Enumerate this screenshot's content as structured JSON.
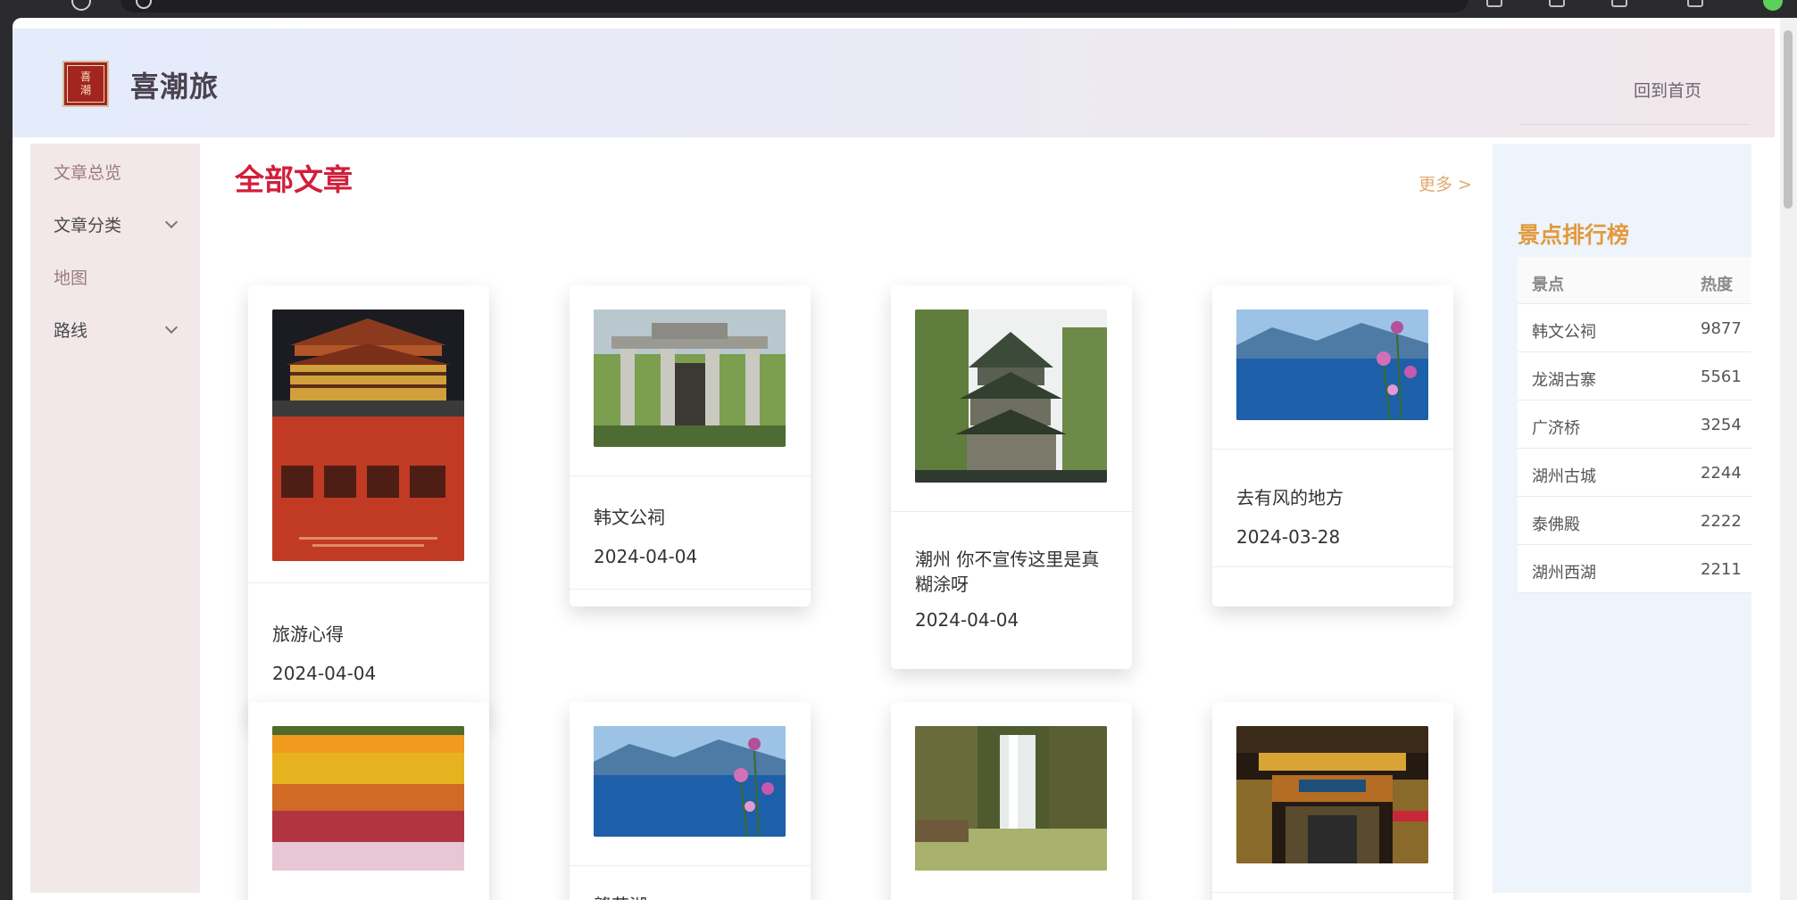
{
  "site": {
    "title": "喜潮旅",
    "logo_text_top": "喜",
    "logo_text_bottom": "潮",
    "home_link": "回到首页"
  },
  "sidebar": {
    "items": [
      {
        "label": "文章总览"
      },
      {
        "label": "文章分类"
      },
      {
        "label": "地图"
      },
      {
        "label": "路线"
      }
    ]
  },
  "main": {
    "section_title": "全部文章",
    "more_link": "更多 >",
    "articles": [
      {
        "title": "旅游心得",
        "date": "2024-04-04",
        "image": "chaozhou-prefecture-gate-photo"
      },
      {
        "title": "韩文公祠",
        "date": "2024-04-04",
        "image": "stone-archway-photo"
      },
      {
        "title": "潮州 你不宣传这里是真糊涂呀",
        "date": "2024-04-04",
        "image": "pagoda-pavilion-photo"
      },
      {
        "title": "去有风的地方",
        "date": "2024-03-28",
        "image": "lake-flowers-photo"
      },
      {
        "title": "",
        "date": "",
        "image": "flower-field-photo"
      },
      {
        "title": "赣花湖",
        "date": "",
        "image": "lake-flowers-photo"
      },
      {
        "title": "",
        "date": "",
        "image": "waterfall-photo"
      },
      {
        "title": "",
        "date": "",
        "image": "night-gateway-photo"
      }
    ]
  },
  "ranking": {
    "title": "景点排行榜",
    "columns": [
      "景点",
      "热度"
    ],
    "rows": [
      {
        "name": "韩文公祠",
        "heat": "9877"
      },
      {
        "name": "龙湖古寨",
        "heat": "5561"
      },
      {
        "name": "广济桥",
        "heat": "3254"
      },
      {
        "name": "湖州古城",
        "heat": "2244"
      },
      {
        "name": "泰佛殿",
        "heat": "2222"
      },
      {
        "name": "湖州西湖",
        "heat": "2211"
      }
    ]
  },
  "colors": {
    "accent_red": "#d11f3a",
    "accent_orange": "#e29a3f",
    "sidebar_bg": "#f2e8ea",
    "rank_bg": "#eef4fb"
  }
}
